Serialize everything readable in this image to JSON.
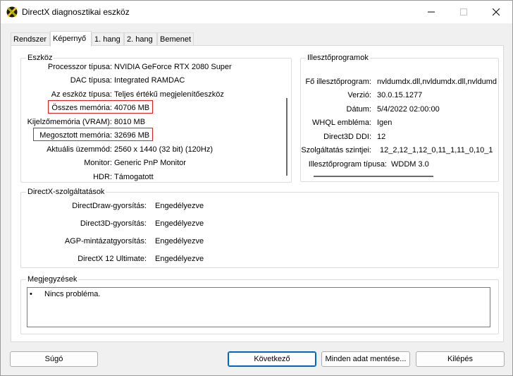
{
  "window": {
    "title": "DirectX diagnosztikai eszköz"
  },
  "tabs": [
    {
      "label": "Rendszer"
    },
    {
      "label": "Képernyő"
    },
    {
      "label": "1. hang"
    },
    {
      "label": "2. hang"
    },
    {
      "label": "Bemenet"
    }
  ],
  "device": {
    "title": "Eszköz",
    "rows": [
      {
        "label": "Processzor típusa:",
        "value": "NVIDIA GeForce RTX 2080 Super"
      },
      {
        "label": "DAC típusa:",
        "value": "Integrated RAMDAC"
      },
      {
        "label": "Az eszköz típusa:",
        "value": "Teljes értékű megjelenítőeszköz"
      },
      {
        "label": "Összes memória:",
        "value": "40706 MB"
      },
      {
        "label": "Kijelzőmemória (VRAM):",
        "value": "8010 MB"
      },
      {
        "label": "Megosztott memória:",
        "value": "32696 MB"
      },
      {
        "label": "Aktuális üzemmód:",
        "value": "2560 x 1440 (32 bit) (120Hz)"
      },
      {
        "label": "Monitor:",
        "value": "Generic PnP Monitor"
      },
      {
        "label": "HDR:",
        "value": "Támogatott"
      }
    ]
  },
  "drivers": {
    "title": "Illesztőprogramok",
    "rows": [
      {
        "label": "Fő illesztőprogram:",
        "value": "nvldumdx.dll,nvldumdx.dll,nvldumd"
      },
      {
        "label": "Verzió:",
        "value": "30.0.15.1277"
      },
      {
        "label": "Dátum:",
        "value": "5/4/2022 02:00:00"
      },
      {
        "label": "WHQL embléma:",
        "value": "Igen"
      },
      {
        "label": "Direct3D DDI:",
        "value": "12"
      },
      {
        "label": "Szolgáltatás szintjei:",
        "value": "12_2,12_1,12_0,11_1,11_0,10_1"
      },
      {
        "label": "Illesztőprogram típusa:",
        "value": "WDDM 3.0"
      }
    ]
  },
  "features": {
    "title": "DirectX-szolgáltatások",
    "rows": [
      {
        "label": "DirectDraw-gyorsítás:",
        "value": "Engedélyezve"
      },
      {
        "label": "Direct3D-gyorsítás:",
        "value": "Engedélyezve"
      },
      {
        "label": "AGP-mintázatgyorsítás:",
        "value": "Engedélyezve"
      },
      {
        "label": "DirectX 12 Ultimate:",
        "value": "Engedélyezve"
      }
    ]
  },
  "notes": {
    "title": "Megjegyzések",
    "bullet": "•",
    "text": "Nincs probléma."
  },
  "buttons": {
    "help": "Súgó",
    "next": "Következő",
    "save_all": "Minden adat mentése...",
    "exit": "Kilépés"
  },
  "colors": {
    "highlight": "#e02020",
    "default_button_border": "#0067c0"
  }
}
